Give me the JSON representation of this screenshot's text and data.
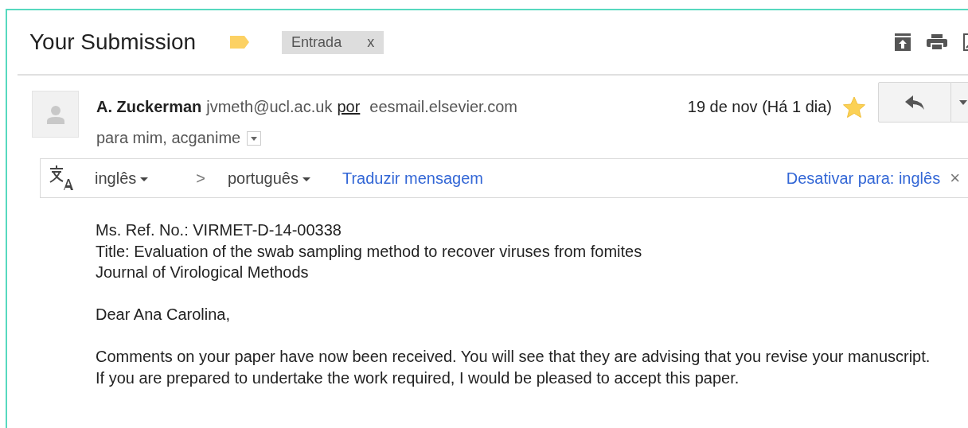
{
  "subject": {
    "title": "Your Submission",
    "label": {
      "text": "Entrada",
      "remove": "x"
    }
  },
  "sender": {
    "name": "A. Zuckerman",
    "email": "jvmeth@ucl.ac.uk",
    "via": "por",
    "domain": "eesmail.elsevier.com",
    "recipients": "para mim, acganime",
    "date": "19 de nov (Há 1 dia)",
    "starred": true
  },
  "translate": {
    "source": "inglês",
    "separator": ">",
    "target": "português",
    "action": "Traduzir mensagem",
    "disable": "Desativar para: inglês",
    "close": "×"
  },
  "body": [
    [
      "Ms. Ref. No.:  VIRMET-D-14-00338",
      "Title: Evaluation of the swab sampling method to recover viruses from fomites",
      "Journal of Virological Methods"
    ],
    [
      "Dear Ana Carolina,"
    ],
    [
      "Comments on your paper have now been received. You will see that they are advising that you revise your manuscript. If you are prepared to undertake the work required, I would be pleased to accept this paper."
    ]
  ]
}
